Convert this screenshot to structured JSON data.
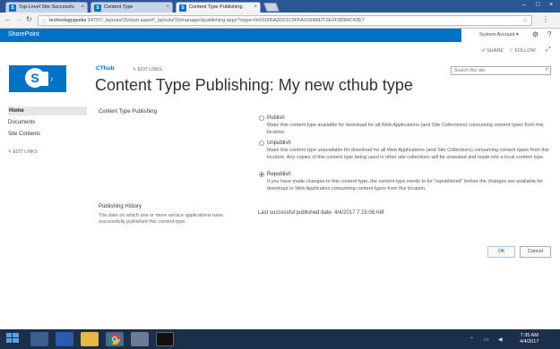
{
  "browser": {
    "tabs": [
      {
        "label": "Top-Level Site Successfu",
        "favicon": "S",
        "active": false
      },
      {
        "label": "Content Type",
        "favicon": "S",
        "active": false
      },
      {
        "label": "Content Type Publishing",
        "favicon": "S",
        "active": true
      }
    ],
    "url_host": "technologygeeks",
    "url_rest": ":14797/_layouts/15/start.aspx#/_layouts/15/managectpublishing.aspx?ctype=0x01006A3D01C9FFA1634987F3E0F9D84C42E7"
  },
  "suitebar": {
    "brand": "SharePoint",
    "system_account": "System Account ▾"
  },
  "pagebar": {
    "share": "SHARE",
    "follow": "FOLLOW"
  },
  "site": {
    "name": "CThub",
    "edit_links": "EDIT LINKS",
    "page_title": "Content Type Publishing: My new cthub type",
    "search_placeholder": "Search this site"
  },
  "leftnav": {
    "items": [
      "Home",
      "Documents",
      "Site Contents"
    ],
    "edit_links": "EDIT LINKS"
  },
  "form": {
    "section_title": "Content Type Publishing",
    "options": [
      {
        "label": "Publish",
        "desc": "Make this content type available for download for all Web Applications (and Site Collections) consuming content types from this location.",
        "checked": false
      },
      {
        "label": "Unpublish",
        "desc": "Make this content type unavailable for download for all Web Applications (and Site Collections) consuming content types from this location. Any copies of this content type being used in other site collections will be unsealed and made into a local content type.",
        "checked": false
      },
      {
        "label": "Republish",
        "desc": "If you have made changes to this content type, the content type needs to be \"republished\" before the changes are available for download to Web Application consuming content types from this location.",
        "checked": true
      }
    ],
    "history_title": "Publishing History",
    "history_desc": "The date on which one or more service applications have successfully published this content type.",
    "last_published": "Last successful published date: 4/4/2017 7:15:06 AM",
    "ok": "OK",
    "cancel": "Cancel"
  },
  "taskbar": {
    "time": "7:35 AM",
    "date": "4/4/2017"
  }
}
